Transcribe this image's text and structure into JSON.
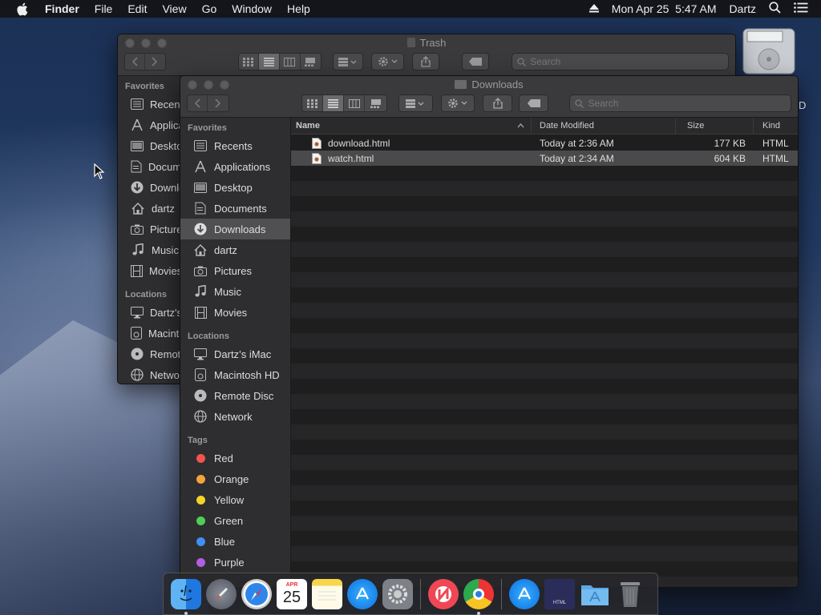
{
  "menubar": {
    "app_name": "Finder",
    "items": [
      "File",
      "Edit",
      "View",
      "Go",
      "Window",
      "Help"
    ],
    "clock": "Mon Apr 25  5:47 AM",
    "user": "Dartz"
  },
  "back_window": {
    "title": "Trash",
    "search_placeholder": "Search",
    "sidebar": {
      "favorites_label": "Favorites",
      "favorites": [
        "Recents",
        "Applications",
        "Desktop",
        "Documents",
        "Downloads",
        "dartz",
        "Pictures",
        "Music",
        "Movies"
      ],
      "locations_label": "Locations",
      "locations": [
        "Dartz's iMac",
        "Macintosh HD",
        "Remote Disc",
        "Network"
      ]
    }
  },
  "front_window": {
    "title": "Downloads",
    "search_placeholder": "Search",
    "sidebar": {
      "favorites_label": "Favorites",
      "favorites": [
        "Recents",
        "Applications",
        "Desktop",
        "Documents",
        "Downloads",
        "dartz",
        "Pictures",
        "Music",
        "Movies"
      ],
      "selected": "Downloads",
      "locations_label": "Locations",
      "locations": [
        "Dartz’s iMac",
        "Macintosh HD",
        "Remote Disc",
        "Network"
      ],
      "tags_label": "Tags",
      "tags": [
        {
          "name": "Red",
          "color": "#f2544e"
        },
        {
          "name": "Orange",
          "color": "#f5a33a"
        },
        {
          "name": "Yellow",
          "color": "#f5d328"
        },
        {
          "name": "Green",
          "color": "#4cd055"
        },
        {
          "name": "Blue",
          "color": "#3f8ff5"
        },
        {
          "name": "Purple",
          "color": "#b35ee0"
        }
      ]
    },
    "columns": {
      "name": "Name",
      "date": "Date Modified",
      "size": "Size",
      "kind": "Kind"
    },
    "files": [
      {
        "name": "download.html",
        "date": "Today at 2:36 AM",
        "size": "177 KB",
        "kind": "HTML"
      },
      {
        "name": "watch.html",
        "date": "Today at 2:34 AM",
        "size": "604 KB",
        "kind": "HTML"
      }
    ]
  },
  "dock": {
    "calendar_month": "APR",
    "calendar_day": "25",
    "doc_label": "HTML"
  },
  "desktop_icon_label": "D"
}
